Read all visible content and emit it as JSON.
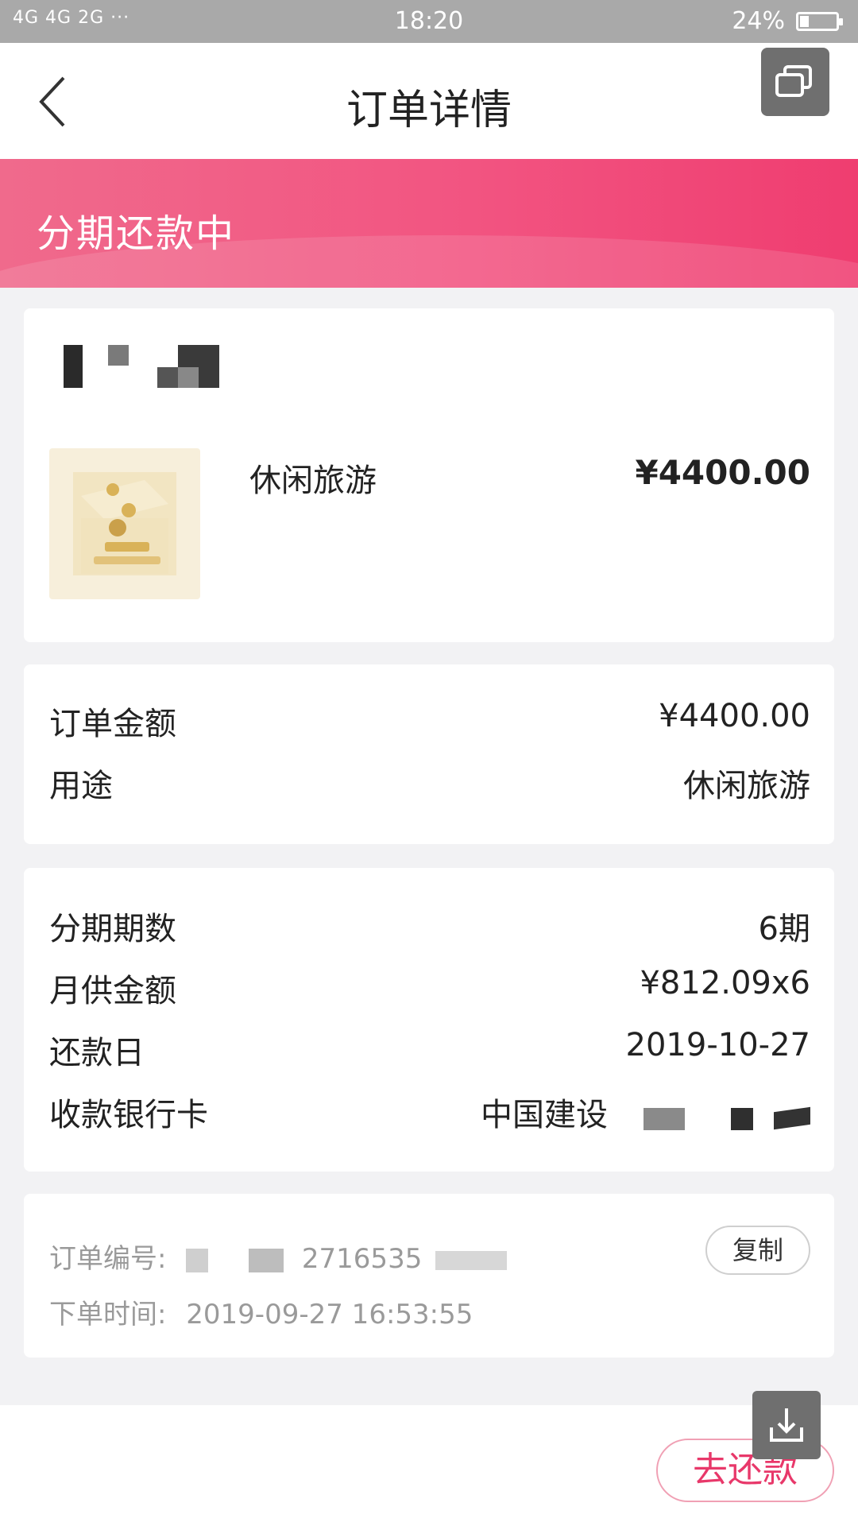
{
  "status_bar": {
    "signal_text": "4G 4G  2G  ···",
    "time": "18:20",
    "battery_text": "24%",
    "battery_level": 0.24
  },
  "header": {
    "title": "订单详情",
    "back_icon": "chevron-left-icon",
    "window_icon": "multi-window-icon"
  },
  "banner": {
    "status": "分期还款中",
    "colors": [
      "#f06a8c",
      "#ef3d70"
    ]
  },
  "product": {
    "name": "休闲旅游",
    "price": "¥4400.00",
    "thumbnail_icon": "gold-coins-cube-icon"
  },
  "order_summary": [
    {
      "label": "订单金额",
      "value": "¥4400.00"
    },
    {
      "label": "用途",
      "value": "休闲旅游"
    }
  ],
  "plan_details": [
    {
      "label": "分期期数",
      "value": "6期"
    },
    {
      "label": "月供金额",
      "value": "¥812.09x6"
    },
    {
      "label": "还款日",
      "value": "2019-10-27"
    },
    {
      "label": "收款银行卡",
      "value": "中国建设"
    }
  ],
  "meta": {
    "order_no_label": "订单编号:",
    "order_no_value": "2716535",
    "order_time_label": "下单时间:",
    "order_time_value": "2019-09-27 16:53:55",
    "copy_label": "复制"
  },
  "footer": {
    "pay_label": "去还款",
    "download_icon": "download-icon"
  },
  "colors": {
    "accent": "#ef3d70",
    "pay_text": "#e8386a"
  }
}
